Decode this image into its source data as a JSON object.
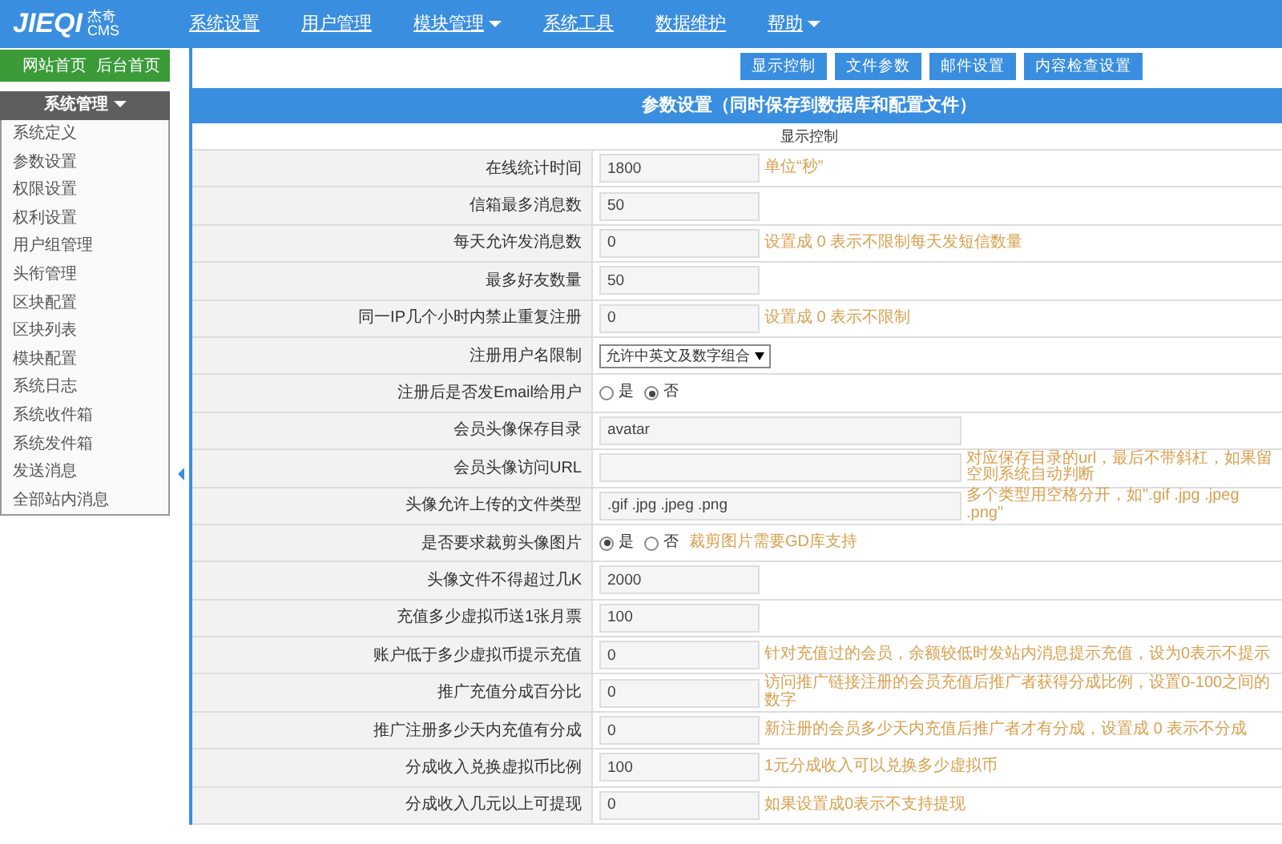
{
  "logo": {
    "text": "JIEQI",
    "sub_top": "杰奇",
    "sub_bottom": "CMS"
  },
  "nav": [
    {
      "label": "系统设置",
      "dropdown": false
    },
    {
      "label": "用户管理",
      "dropdown": false
    },
    {
      "label": "模块管理",
      "dropdown": true
    },
    {
      "label": "系统工具",
      "dropdown": false
    },
    {
      "label": "数据维护",
      "dropdown": false
    },
    {
      "label": "帮助",
      "dropdown": true
    }
  ],
  "sidebar": {
    "links": [
      "网站首页",
      "后台首页"
    ],
    "section": "系统管理",
    "items": [
      "系统定义",
      "参数设置",
      "权限设置",
      "权利设置",
      "用户组管理",
      "头衔管理",
      "区块配置",
      "区块列表",
      "模块配置",
      "系统日志",
      "系统收件箱",
      "系统发件箱",
      "发送消息",
      "全部站内消息"
    ]
  },
  "tab_buttons": [
    "显示控制",
    "文件参数",
    "邮件设置",
    "内容检查设置"
  ],
  "panel": {
    "title": "参数设置（同时保存到数据库和配置文件）",
    "subtitle": "显示控制"
  },
  "rows": [
    {
      "label": "在线统计时间",
      "kind": "text",
      "value": "1800",
      "wide": false,
      "hint": "单位“秒”"
    },
    {
      "label": "信箱最多消息数",
      "kind": "text",
      "value": "50",
      "wide": false
    },
    {
      "label": "每天允许发消息数",
      "kind": "text",
      "value": "0",
      "wide": false,
      "hint": "设置成 0 表示不限制每天发短信数量"
    },
    {
      "label": "最多好友数量",
      "kind": "text",
      "value": "50",
      "wide": false
    },
    {
      "label": "同一IP几个小时内禁止重复注册",
      "kind": "text",
      "value": "0",
      "wide": false,
      "hint": "设置成 0 表示不限制"
    },
    {
      "label": "注册用户名限制",
      "kind": "select",
      "value": "允许中英文及数字组合"
    },
    {
      "label": "注册后是否发Email给用户",
      "kind": "radio",
      "options": [
        {
          "label": "是",
          "selected": false
        },
        {
          "label": "否",
          "selected": true
        }
      ]
    },
    {
      "label": "会员头像保存目录",
      "kind": "text",
      "value": "avatar",
      "wide": true
    },
    {
      "label": "会员头像访问URL",
      "kind": "text",
      "wide": true,
      "hint": "对应保存目录的url，最后不带斜杠，如果留空则系统自动判断"
    },
    {
      "label": "头像允许上传的文件类型",
      "kind": "text",
      "value": ".gif .jpg .jpeg .png",
      "wide": true,
      "hint": "多个类型用空格分开，如\".gif .jpg .jpeg .png\""
    },
    {
      "label": "是否要求裁剪头像图片",
      "kind": "radio",
      "options": [
        {
          "label": "是",
          "selected": true
        },
        {
          "label": "否",
          "selected": false
        }
      ],
      "hint": "裁剪图片需要GD库支持"
    },
    {
      "label": "头像文件不得超过几K",
      "kind": "text",
      "value": "2000",
      "wide": false
    },
    {
      "label": "充值多少虚拟币送1张月票",
      "kind": "text",
      "value": "100",
      "wide": false
    },
    {
      "label": "账户低于多少虚拟币提示充值",
      "kind": "text",
      "value": "0",
      "wide": false,
      "hint": "针对充值过的会员，余额较低时发站内消息提示充值，设为0表示不提示"
    },
    {
      "label": "推广充值分成百分比",
      "kind": "text",
      "value": "0",
      "wide": false,
      "hint": "访问推广链接注册的会员充值后推广者获得分成比例，设置0-100之间的数字"
    },
    {
      "label": "推广注册多少天内充值有分成",
      "kind": "text",
      "value": "0",
      "wide": false,
      "hint": "新注册的会员多少天内充值后推广者才有分成，设置成 0 表示不分成"
    },
    {
      "label": "分成收入兑换虚拟币比例",
      "kind": "text",
      "value": "100",
      "wide": false,
      "hint": "1元分成收入可以兑换多少虚拟币"
    },
    {
      "label": "分成收入几元以上可提现",
      "kind": "text",
      "value": "0",
      "wide": false,
      "hint": "如果设置成0表示不支持提现"
    }
  ]
}
